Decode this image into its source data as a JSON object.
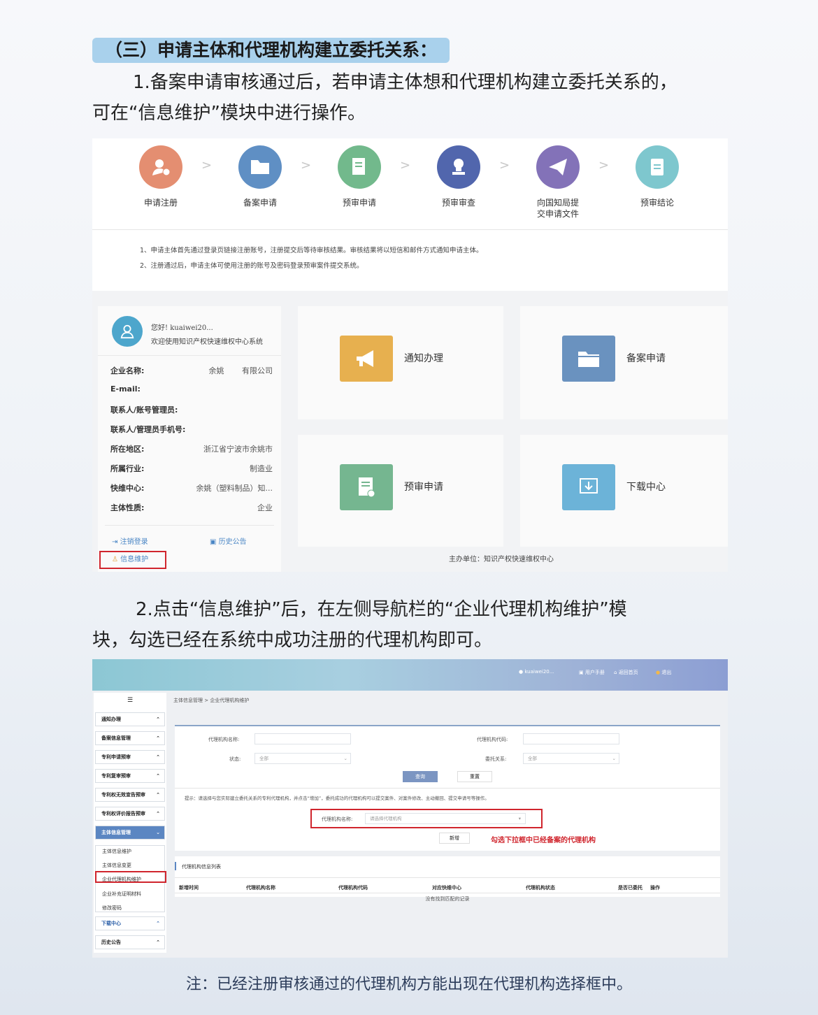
{
  "section_title": "（三）申请主体和代理机构建立委托关系：",
  "para1": "1.备案申请审核通过后，若申请主体想和代理机构建立委托关系的，可在“信息维护”模块中进行操作。",
  "para1_line1": "1.备案申请审核通过后，若申请主体想和代理机构建立委托关系的，",
  "para1_line2": "可在“信息维护”模块中进行操作。",
  "steps": [
    {
      "label": "申请注册",
      "icon": "user-add-icon",
      "color": "#e48e71"
    },
    {
      "label": "备案申请",
      "icon": "folder-icon",
      "color": "#5f8fc4"
    },
    {
      "label": "预审申请",
      "icon": "document-icon",
      "color": "#72b98c"
    },
    {
      "label": "预审审查",
      "icon": "stamp-icon",
      "color": "#5166ad"
    },
    {
      "label": "向国知局提交申请文件",
      "label_l1": "向国知局提",
      "label_l2": "交申请文件",
      "icon": "paper-plane-icon",
      "color": "#8372b8"
    },
    {
      "label": "预审结论",
      "icon": "file-icon",
      "color": "#7ec7ce"
    }
  ],
  "step_arrow": ">",
  "notes": [
    "1、申请主体首先通过登录页链接注册账号，注册提交后等待审核结果。审核结果将以短信和邮件方式通知申请主体。",
    "2、注册通过后，申请主体可使用注册的账号及密码登录预审案件提交系统。"
  ],
  "user": {
    "greeting": "您好! kuaiwei20...",
    "welcome": "欢迎使用知识产权快速维权中心系统"
  },
  "info": [
    {
      "k": "企业名称:",
      "v": "余姚　　 有限公司"
    },
    {
      "k": "E-mail:",
      "v": ""
    },
    {
      "k": "联系人/账号管理员:",
      "v": ""
    },
    {
      "k": "联系人/管理员手机号:",
      "v": ""
    },
    {
      "k": "所在地区:",
      "v": "浙江省宁波市余姚市"
    },
    {
      "k": "所属行业:",
      "v": "制造业"
    },
    {
      "k": "快维中心:",
      "v": "余姚（塑料制品）知..."
    },
    {
      "k": "主体性质:",
      "v": "企业"
    }
  ],
  "links": {
    "logout": "注销登录",
    "history": "历史公告",
    "info_maintain": "信息维护"
  },
  "tiles": [
    {
      "label": "通知办理",
      "icon": "megaphone-icon",
      "color": "#e7b04f"
    },
    {
      "label": "备案申请",
      "icon": "folder-icon",
      "color": "#6a92bf"
    },
    {
      "label": "预审申请",
      "icon": "document-icon",
      "color": "#75b690"
    },
    {
      "label": "下载中心",
      "icon": "download-icon",
      "color": "#6cb3d8"
    }
  ],
  "sponsor": "主办单位：知识产权快速维权中心",
  "para2_line1": "2.点击“信息维护”后，在左侧导航栏的“企业代理机构维护”模",
  "para2_line2": "块，勾选已经在系统中成功注册的代理机构即可。",
  "topbar": {
    "user": "kuaiwei20...",
    "manual": "用户手册",
    "home": "返回首页",
    "exit": "退出"
  },
  "nav": {
    "menu_icon": "☰",
    "items": [
      "通知办理",
      "备案信息管理",
      "专利申请预审",
      "专利复审预审",
      "专利权无效宣告预审",
      "专利权评价报告预审",
      "主体信息管理"
    ],
    "sub": [
      "主体信息维护",
      "主体信息变更",
      "企业代理机构维护",
      "企业补充证明材料",
      "修改密码"
    ],
    "bottom": [
      "下载中心",
      "历史公告"
    ]
  },
  "breadcrumb": "主体信息管理 > 企业代理机构维护",
  "form": {
    "name_label": "代理机构名称:",
    "code_label": "代理机构代码:",
    "status_label": "状态:",
    "status_value": "全部",
    "relation_label": "委托关系:",
    "relation_value": "全部",
    "query": "查询",
    "reset": "重置",
    "tip": "提示：请选择与您实际建立委托关系的专利代理机构，并点击“增加”，委托成功的代理机构可以提交案件、对案件修改、主动撤回、提交申请号等操作。",
    "select_label": "代理机构名称:",
    "select_placeholder": "请选择代理机构",
    "add": "新增",
    "annotation": "勾选下拉框中已经备案的代理机构"
  },
  "table": {
    "title": "代理机构信息列表",
    "columns": [
      "新增时间",
      "代理机构名称",
      "代理机构代码",
      "对应快维中心",
      "代理机构状态",
      "是否已委托",
      "操作"
    ],
    "empty": "没有找到匹配的记录"
  },
  "footnote": "注：已经注册审核通过的代理机构方能出现在代理机构选择框中。",
  "colors": {
    "highlight_red": "#d0252d",
    "pill": "#a9d1ec"
  }
}
